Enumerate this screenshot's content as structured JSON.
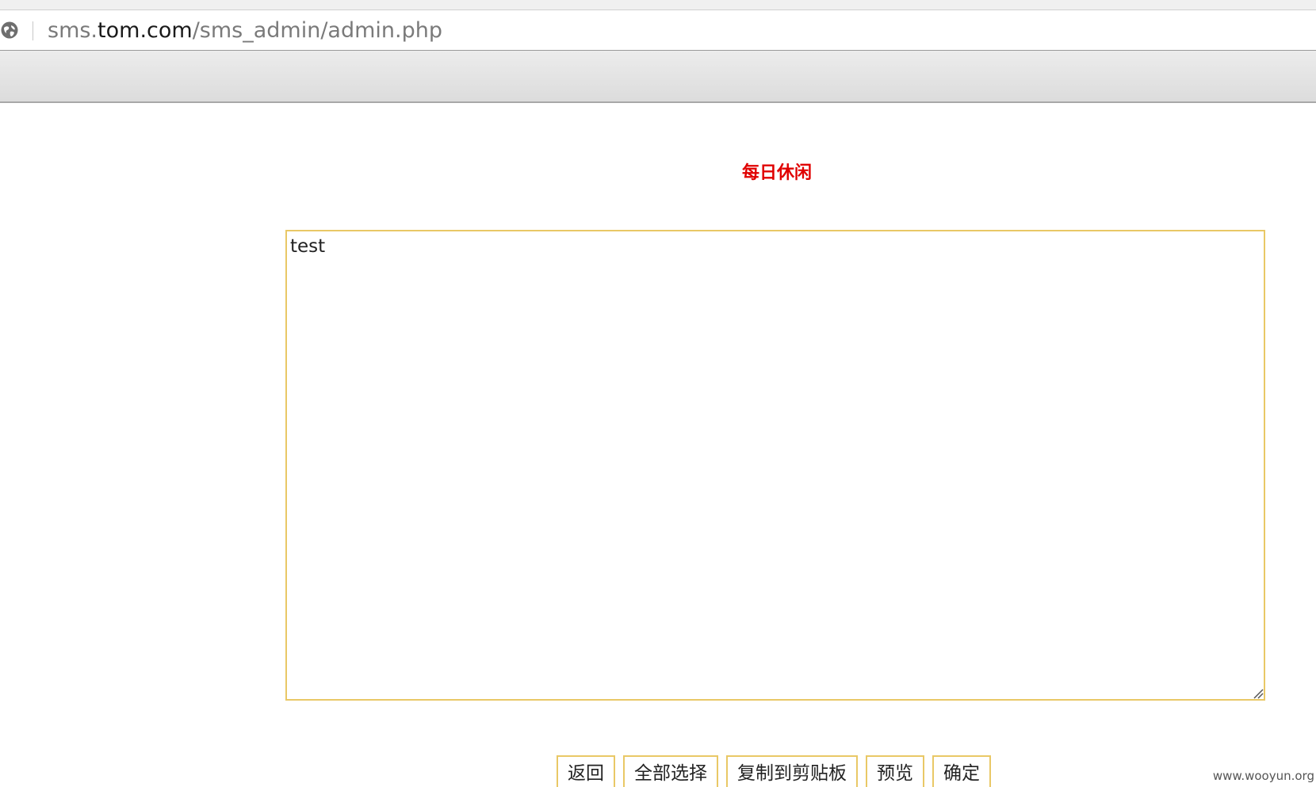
{
  "browser": {
    "url_prefix": "sms.",
    "url_host": "tom.com",
    "url_path": "/sms_admin/admin.php"
  },
  "page": {
    "title": "每日休闲",
    "textarea_value": "test"
  },
  "buttons": {
    "back": "返回",
    "select_all": "全部选择",
    "copy_clipboard": "复制到剪贴板",
    "preview": "预览",
    "confirm": "确定"
  },
  "watermark": "www.wooyun.org",
  "colors": {
    "title": "#e00000",
    "border_accent": "#e9c866"
  }
}
